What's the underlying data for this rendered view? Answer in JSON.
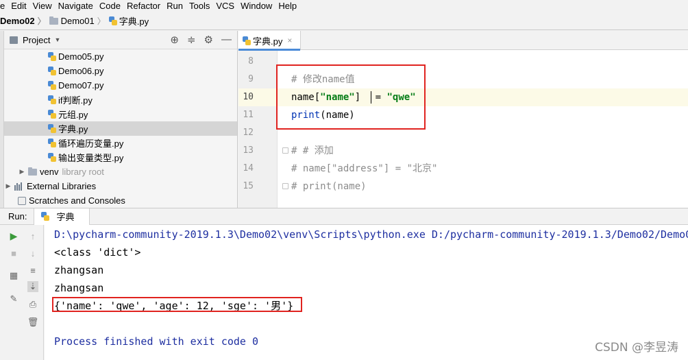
{
  "menu": [
    "e",
    "Edit",
    "View",
    "Navigate",
    "Code",
    "Refactor",
    "Run",
    "Tools",
    "VCS",
    "Window",
    "Help"
  ],
  "breadcrumb": {
    "project": "Demo02",
    "folder": "Demo01",
    "file": "字典.py"
  },
  "project_panel": {
    "title": "Project",
    "items": [
      {
        "label": "Demo05.py"
      },
      {
        "label": "Demo06.py"
      },
      {
        "label": "Demo07.py"
      },
      {
        "label": "if判断.py"
      },
      {
        "label": "元组.py"
      },
      {
        "label": "字典.py",
        "selected": true
      },
      {
        "label": "循环遍历变量.py"
      },
      {
        "label": "输出变量类型.py"
      }
    ],
    "venv": {
      "label": "venv",
      "hint": "library root"
    },
    "external": "External Libraries",
    "scratches": "Scratches and Consoles"
  },
  "editor": {
    "tab": "字典.py",
    "lines": [
      {
        "n": "8"
      },
      {
        "n": "9",
        "comment": "# 修改name值"
      },
      {
        "n": "10",
        "var": "name[",
        "key": "\"name\"",
        "close": "]",
        "eq": "=",
        "val": "\"qwe\""
      },
      {
        "n": "11",
        "fn": "print",
        "args": "(name)"
      },
      {
        "n": "12"
      },
      {
        "n": "13",
        "comment": "# # 添加"
      },
      {
        "n": "14",
        "comment": "# name[\"address\"] = \"北京\""
      },
      {
        "n": "15",
        "comment": "# print(name)"
      }
    ]
  },
  "run": {
    "label": "Run:",
    "tab": "字典",
    "output": [
      "D:\\pycharm-community-2019.1.3\\Demo02\\venv\\Scripts\\python.exe D:/pycharm-community-2019.1.3/Demo02/Demo0",
      "<class 'dict'>",
      "zhangsan",
      "zhangsan",
      "{'name': 'qwe', 'age': 12, 'sge': '男'}",
      "",
      "Process finished with exit code 0"
    ]
  },
  "watermark": "CSDN @李昱涛",
  "colors": {
    "highlight_box": "#e0231f",
    "tab_accent": "#4b8bd8",
    "string": "#067d17",
    "keyword": "#0033b3"
  }
}
